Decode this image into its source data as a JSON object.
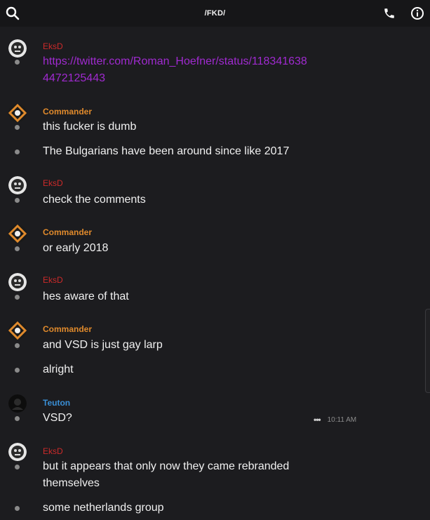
{
  "header": {
    "title": "/FKD/",
    "search_icon": "search-icon",
    "call_icon": "phone-icon",
    "info_icon": "info-icon"
  },
  "users": {
    "eksd": {
      "name": "EksD",
      "color": "#cc2a2a"
    },
    "commander": {
      "name": "Commander",
      "color": "#e08a2c"
    },
    "teuton": {
      "name": "Teuton",
      "color": "#3a8fd6"
    }
  },
  "messages": [
    {
      "author": "EksD",
      "link_line1": "https://twitter.com/Roman_Hoefner/status/118341638",
      "link_line2": "4472125443"
    },
    {
      "author": "Commander",
      "lines": [
        "this fucker is dumb",
        "The Bulgarians have been around since like 2017"
      ]
    },
    {
      "author": "EksD",
      "lines": [
        "check the comments"
      ]
    },
    {
      "author": "Commander",
      "lines": [
        "or early 2018"
      ]
    },
    {
      "author": "EksD",
      "lines": [
        "hes aware of that"
      ]
    },
    {
      "author": "Commander",
      "lines": [
        "and VSD is just gay larp",
        "alright"
      ]
    },
    {
      "author": "Teuton",
      "lines": [
        "VSD?"
      ],
      "time": "10:11 AM",
      "more": "•••"
    },
    {
      "author": "EksD",
      "line_a": "but it appears that only now they came rebranded",
      "line_b": "themselves",
      "line_c": "some netherlands group"
    }
  ]
}
